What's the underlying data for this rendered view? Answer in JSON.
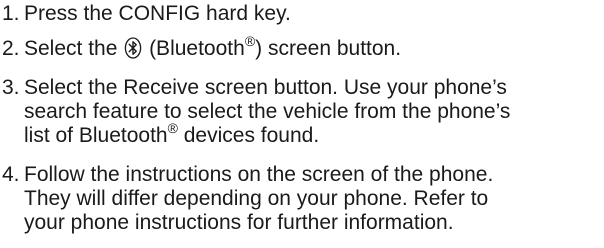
{
  "steps": [
    {
      "number": "1.",
      "lines": [
        {
          "text": "Press the CONFIG hard key."
        }
      ]
    },
    {
      "number": "2.",
      "lines": [
        {
          "before_icon": "Select the ",
          "icon": "bluetooth-icon",
          "after_icon": " (Bluetooth",
          "sup": "®",
          "after_sup": ") screen button."
        }
      ]
    },
    {
      "number": "3.",
      "lines": [
        {
          "text": "Select the Receive screen button. Use your phone’s"
        },
        {
          "text": "search feature to select the vehicle from the phone’s"
        },
        {
          "before_sup": "list of Bluetooth",
          "sup": "®",
          "after_sup": " devices found."
        }
      ]
    },
    {
      "number": "4.",
      "lines": [
        {
          "text": "Follow the instructions on the screen of the phone."
        },
        {
          "text": "They will differ depending on your phone. Refer to"
        },
        {
          "text": "your phone instructions for further information."
        }
      ]
    }
  ]
}
